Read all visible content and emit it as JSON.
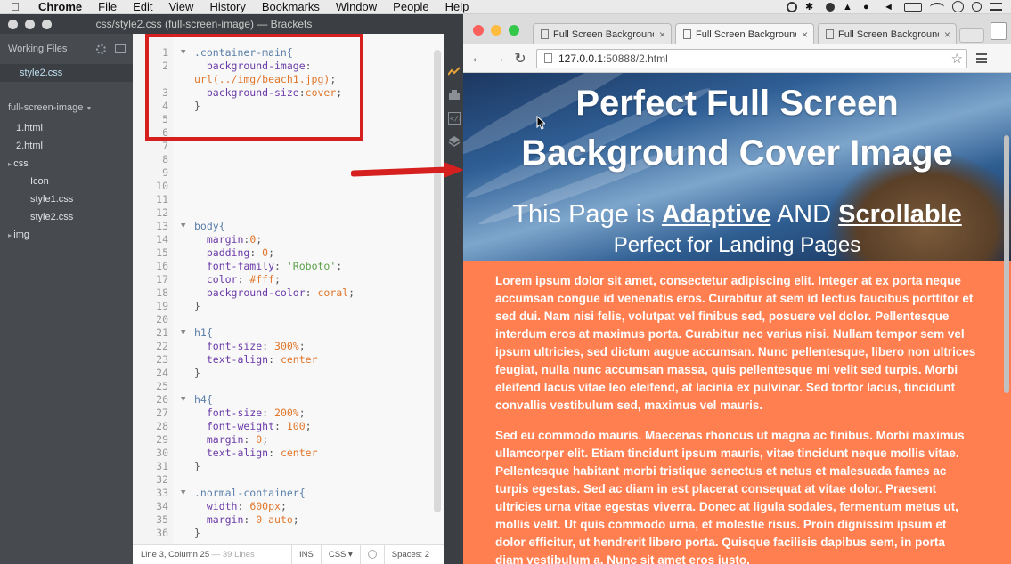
{
  "menubar": {
    "app": "Chrome",
    "items": [
      "File",
      "Edit",
      "View",
      "History",
      "Bookmarks",
      "Window",
      "People",
      "Help"
    ],
    "tray_icons": [
      "record-icon",
      "bluetooth-icon",
      "creative-cloud-icon",
      "drive-icon",
      "notification-icon",
      "volume-icon",
      "battery-icon",
      "wifi-icon",
      "clock-icon",
      "spotlight-icon",
      "notification-center-icon"
    ]
  },
  "brackets": {
    "window_title": "css/style2.css (full-screen-image) — Brackets",
    "working_files_label": "Working Files",
    "working_files": [
      "style2.css"
    ],
    "project_label": "full-screen-image",
    "tree": [
      {
        "label": "1.html",
        "indent": 1
      },
      {
        "label": "2.html",
        "indent": 1
      },
      {
        "label": "css",
        "indent": 0,
        "folder": true
      },
      {
        "label": "Icon",
        "indent": 2
      },
      {
        "label": "style1.css",
        "indent": 2
      },
      {
        "label": "style2.css",
        "indent": 2
      },
      {
        "label": "img",
        "indent": 0,
        "folder": true
      }
    ],
    "code_lines": [
      {
        "n": "1",
        "fold": "▼",
        "parts": [
          [
            "sel",
            ".container-main{"
          ]
        ]
      },
      {
        "n": "2",
        "fold": "",
        "parts": [
          [
            "prop",
            "  background-image"
          ],
          [
            "plain",
            ":"
          ]
        ]
      },
      {
        "n": "",
        "fold": "",
        "parts": [
          [
            "val",
            "url(../img/beach1.jpg)"
          ],
          [
            "plain",
            ";"
          ]
        ]
      },
      {
        "n": "3",
        "fold": "",
        "parts": [
          [
            "prop",
            "  background-size"
          ],
          [
            "plain",
            ":"
          ],
          [
            "val",
            "cover"
          ],
          [
            "plain",
            ";"
          ]
        ]
      },
      {
        "n": "4",
        "fold": "",
        "parts": [
          [
            "plain",
            "}"
          ]
        ]
      },
      {
        "n": "5",
        "fold": "",
        "parts": []
      },
      {
        "n": "6",
        "fold": "",
        "parts": []
      },
      {
        "n": "7",
        "fold": "",
        "parts": []
      },
      {
        "n": "8",
        "fold": "",
        "parts": []
      },
      {
        "n": "9",
        "fold": "",
        "parts": []
      },
      {
        "n": "10",
        "fold": "",
        "parts": []
      },
      {
        "n": "11",
        "fold": "",
        "parts": []
      },
      {
        "n": "12",
        "fold": "",
        "parts": []
      },
      {
        "n": "13",
        "fold": "▼",
        "parts": [
          [
            "sel",
            "body{"
          ]
        ]
      },
      {
        "n": "14",
        "fold": "",
        "parts": [
          [
            "prop",
            "  margin"
          ],
          [
            "plain",
            ":"
          ],
          [
            "val",
            "0"
          ],
          [
            "plain",
            ";"
          ]
        ]
      },
      {
        "n": "15",
        "fold": "",
        "parts": [
          [
            "prop",
            "  padding"
          ],
          [
            "plain",
            ": "
          ],
          [
            "val",
            "0"
          ],
          [
            "plain",
            ";"
          ]
        ]
      },
      {
        "n": "16",
        "fold": "",
        "parts": [
          [
            "prop",
            "  font-family"
          ],
          [
            "plain",
            ": "
          ],
          [
            "str",
            "'Roboto'"
          ],
          [
            "plain",
            ";"
          ]
        ]
      },
      {
        "n": "17",
        "fold": "",
        "parts": [
          [
            "prop",
            "  color"
          ],
          [
            "plain",
            ": "
          ],
          [
            "val",
            "#fff"
          ],
          [
            "plain",
            ";"
          ]
        ]
      },
      {
        "n": "18",
        "fold": "",
        "parts": [
          [
            "prop",
            "  background-color"
          ],
          [
            "plain",
            ": "
          ],
          [
            "val",
            "coral"
          ],
          [
            "plain",
            ";"
          ]
        ]
      },
      {
        "n": "19",
        "fold": "",
        "parts": [
          [
            "plain",
            "}"
          ]
        ]
      },
      {
        "n": "20",
        "fold": "",
        "parts": []
      },
      {
        "n": "21",
        "fold": "▼",
        "parts": [
          [
            "sel",
            "h1{"
          ]
        ]
      },
      {
        "n": "22",
        "fold": "",
        "parts": [
          [
            "prop",
            "  font-size"
          ],
          [
            "plain",
            ": "
          ],
          [
            "val",
            "300%"
          ],
          [
            "plain",
            ";"
          ]
        ]
      },
      {
        "n": "23",
        "fold": "",
        "parts": [
          [
            "prop",
            "  text-align"
          ],
          [
            "plain",
            ": "
          ],
          [
            "val",
            "center"
          ]
        ]
      },
      {
        "n": "24",
        "fold": "",
        "parts": [
          [
            "plain",
            "}"
          ]
        ]
      },
      {
        "n": "25",
        "fold": "",
        "parts": []
      },
      {
        "n": "26",
        "fold": "▼",
        "parts": [
          [
            "sel",
            "h4{"
          ]
        ]
      },
      {
        "n": "27",
        "fold": "",
        "parts": [
          [
            "prop",
            "  font-size"
          ],
          [
            "plain",
            ": "
          ],
          [
            "val",
            "200%"
          ],
          [
            "plain",
            ";"
          ]
        ]
      },
      {
        "n": "28",
        "fold": "",
        "parts": [
          [
            "prop",
            "  font-weight"
          ],
          [
            "plain",
            ": "
          ],
          [
            "val",
            "100"
          ],
          [
            "plain",
            ";"
          ]
        ]
      },
      {
        "n": "29",
        "fold": "",
        "parts": [
          [
            "prop",
            "  margin"
          ],
          [
            "plain",
            ": "
          ],
          [
            "val",
            "0"
          ],
          [
            "plain",
            ";"
          ]
        ]
      },
      {
        "n": "30",
        "fold": "",
        "parts": [
          [
            "prop",
            "  text-align"
          ],
          [
            "plain",
            ": "
          ],
          [
            "val",
            "center"
          ]
        ]
      },
      {
        "n": "31",
        "fold": "",
        "parts": [
          [
            "plain",
            "}"
          ]
        ]
      },
      {
        "n": "32",
        "fold": "",
        "parts": []
      },
      {
        "n": "33",
        "fold": "▼",
        "parts": [
          [
            "sel",
            ".normal-container{"
          ]
        ]
      },
      {
        "n": "34",
        "fold": "",
        "parts": [
          [
            "prop",
            "  width"
          ],
          [
            "plain",
            ": "
          ],
          [
            "val",
            "600px"
          ],
          [
            "plain",
            ";"
          ]
        ]
      },
      {
        "n": "35",
        "fold": "",
        "parts": [
          [
            "prop",
            "  margin"
          ],
          [
            "plain",
            ": "
          ],
          [
            "val",
            "0 auto"
          ],
          [
            "plain",
            ";"
          ]
        ]
      },
      {
        "n": "36",
        "fold": "",
        "parts": [
          [
            "plain",
            "}"
          ]
        ]
      }
    ],
    "status": {
      "position": "Line 3, Column 25",
      "lines": "— 39 Lines",
      "mode": "INS",
      "language": "CSS ▾",
      "spaces": "Spaces:  2"
    }
  },
  "chrome": {
    "tabs": [
      {
        "label": "Full Screen Background",
        "active": false
      },
      {
        "label": "Full Screen Background",
        "active": true
      },
      {
        "label": "Full Screen Background",
        "active": false
      }
    ],
    "url_host": "127.0.0.1",
    "url_path": ":50888/2.html",
    "page": {
      "h1_line1": "Perfect Full Screen",
      "h1_line2": "Background Cover Image",
      "h4_prefix": "This Page is ",
      "h4_adaptive": "Adaptive",
      "h4_and": " AND ",
      "h4_scrollable": "Scrollable",
      "subtitle": "Perfect for Landing Pages",
      "paragraph1": "Lorem ipsum dolor sit amet, consectetur adipiscing elit. Integer at ex porta neque accumsan congue id venenatis eros. Curabitur at sem id lectus faucibus porttitor et sed dui. Nam nisi felis, volutpat vel finibus sed, posuere vel dolor. Pellentesque interdum eros at maximus porta. Curabitur nec varius nisi. Nullam tempor sem vel ipsum ultricies, sed dictum augue accumsan. Nunc pellentesque, libero non ultrices feugiat, nulla nunc accumsan massa, quis pellentesque mi velit sed turpis. Morbi eleifend lacus vitae leo eleifend, at lacinia ex pulvinar. Sed tortor lacus, tincidunt convallis vestibulum sed, maximus vel mauris.",
      "paragraph2": "Sed eu commodo mauris. Maecenas rhoncus ut magna ac finibus. Morbi maximus ullamcorper elit. Etiam tincidunt ipsum mauris, vitae tincidunt neque mollis vitae. Pellentesque habitant morbi tristique senectus et netus et malesuada fames ac turpis egestas. Sed ac diam in est placerat consequat at vitae dolor. Praesent ultricies urna vitae egestas viverra. Donec at ligula sodales, fermentum metus ut, mollis velit. Ut quis commodo urna, et molestie risus. Proin dignissim ipsum et dolor efficitur, ut hendrerit libero porta. Quisque facilisis dapibus sem, in porta diam vestibulum a. Nunc sit amet eros justo."
    }
  },
  "colors": {
    "page_background": "#ff7f50",
    "highlight": "#d61f1f"
  }
}
